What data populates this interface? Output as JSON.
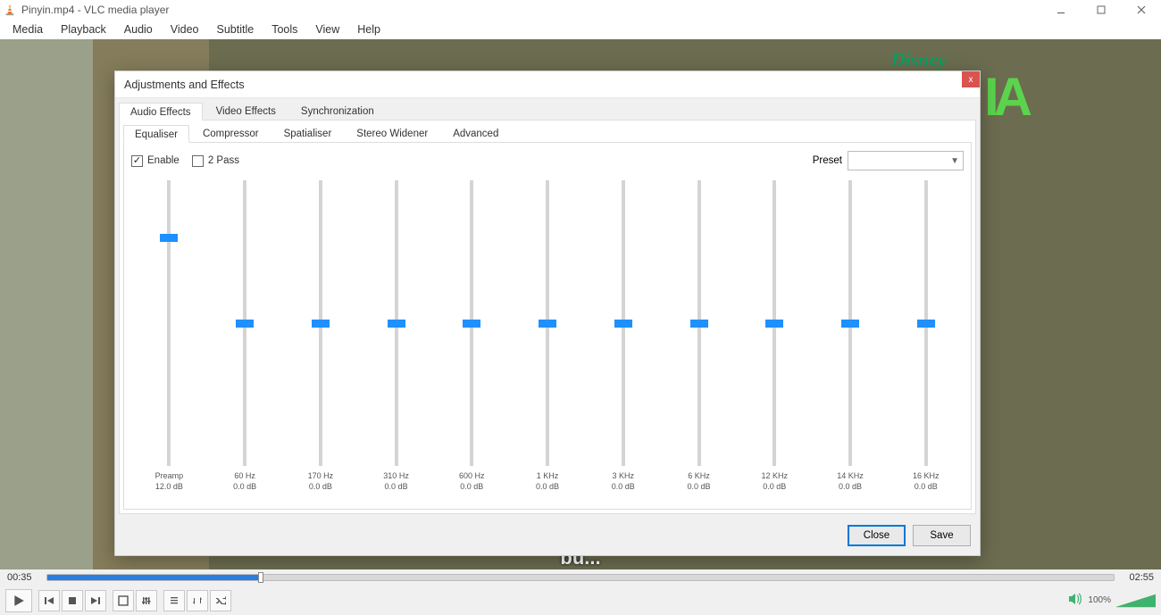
{
  "window": {
    "title": "Pinyin.mp4 - VLC media player"
  },
  "menu": {
    "items": [
      "Media",
      "Playback",
      "Audio",
      "Video",
      "Subtitle",
      "Tools",
      "View",
      "Help"
    ]
  },
  "video": {
    "brand": "Disney",
    "art_text": "IA",
    "subtitle": "bù..."
  },
  "dialog": {
    "title": "Adjustments and Effects",
    "close": "x",
    "tabs": [
      "Audio Effects",
      "Video Effects",
      "Synchronization"
    ],
    "active_tab": 0,
    "subtabs": [
      "Equaliser",
      "Compressor",
      "Spatialiser",
      "Stereo Widener",
      "Advanced"
    ],
    "active_subtab": 0,
    "enable_label": "Enable",
    "enable_checked": true,
    "twopass_label": "2 Pass",
    "twopass_checked": false,
    "preset_label": "Preset",
    "preset_value": "",
    "preamp": {
      "label": "Preamp",
      "value_label": "12.0 dB",
      "pos": 0.2
    },
    "bands": [
      {
        "freq": "60 Hz",
        "value": "0.0 dB",
        "pos": 0.5
      },
      {
        "freq": "170 Hz",
        "value": "0.0 dB",
        "pos": 0.5
      },
      {
        "freq": "310 Hz",
        "value": "0.0 dB",
        "pos": 0.5
      },
      {
        "freq": "600 Hz",
        "value": "0.0 dB",
        "pos": 0.5
      },
      {
        "freq": "1 KHz",
        "value": "0.0 dB",
        "pos": 0.5
      },
      {
        "freq": "3 KHz",
        "value": "0.0 dB",
        "pos": 0.5
      },
      {
        "freq": "6 KHz",
        "value": "0.0 dB",
        "pos": 0.5
      },
      {
        "freq": "12 KHz",
        "value": "0.0 dB",
        "pos": 0.5
      },
      {
        "freq": "14 KHz",
        "value": "0.0 dB",
        "pos": 0.5
      },
      {
        "freq": "16 KHz",
        "value": "0.0 dB",
        "pos": 0.5
      }
    ],
    "buttons": {
      "close": "Close",
      "save": "Save"
    }
  },
  "player": {
    "elapsed": "00:35",
    "remaining": "02:55",
    "progress": 0.2,
    "volume_label": "100%"
  }
}
